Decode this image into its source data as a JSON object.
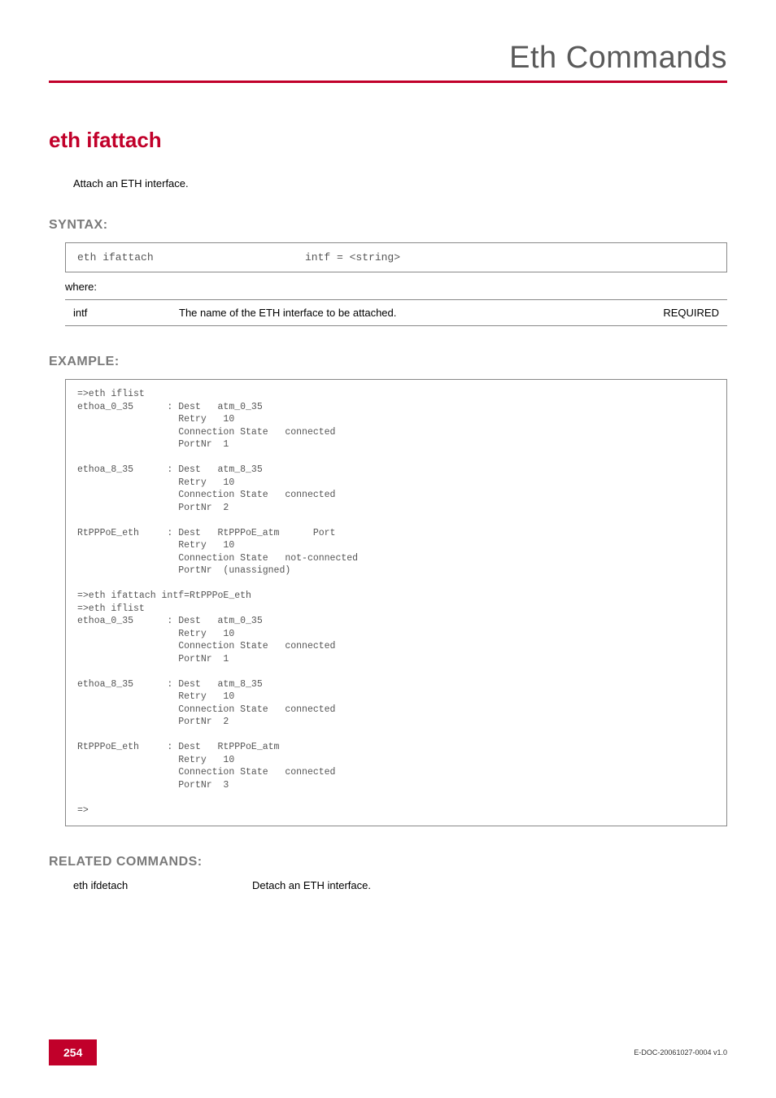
{
  "header": {
    "title": "Eth Commands"
  },
  "command": {
    "name": "eth ifattach",
    "description": "Attach an ETH interface."
  },
  "syntax": {
    "heading": "SYNTAX:",
    "cmd": "eth ifattach",
    "args": "intf = <string>",
    "where_label": "where:",
    "params": [
      {
        "name": "intf",
        "desc": "The name of the ETH interface to be attached.",
        "req": "REQUIRED"
      }
    ]
  },
  "example": {
    "heading": "EXAMPLE:",
    "text": "=>eth iflist\nethoa_0_35      : Dest   atm_0_35\n                  Retry   10\n                  Connection State   connected\n                  PortNr  1\n\nethoa_8_35      : Dest   atm_8_35\n                  Retry   10\n                  Connection State   connected\n                  PortNr  2\n\nRtPPPoE_eth     : Dest   RtPPPoE_atm      Port\n                  Retry   10\n                  Connection State   not-connected\n                  PortNr  (unassigned)\n\n=>eth ifattach intf=RtPPPoE_eth\n=>eth iflist\nethoa_0_35      : Dest   atm_0_35\n                  Retry   10\n                  Connection State   connected\n                  PortNr  1\n\nethoa_8_35      : Dest   atm_8_35\n                  Retry   10\n                  Connection State   connected\n                  PortNr  2\n\nRtPPPoE_eth     : Dest   RtPPPoE_atm\n                  Retry   10\n                  Connection State   connected\n                  PortNr  3\n\n=>"
  },
  "related": {
    "heading": "RELATED COMMANDS:",
    "items": [
      {
        "cmd": "eth ifdetach",
        "desc": "Detach an ETH interface."
      }
    ]
  },
  "footer": {
    "page": "254",
    "docid": "E-DOC-20061027-0004 v1.0"
  }
}
